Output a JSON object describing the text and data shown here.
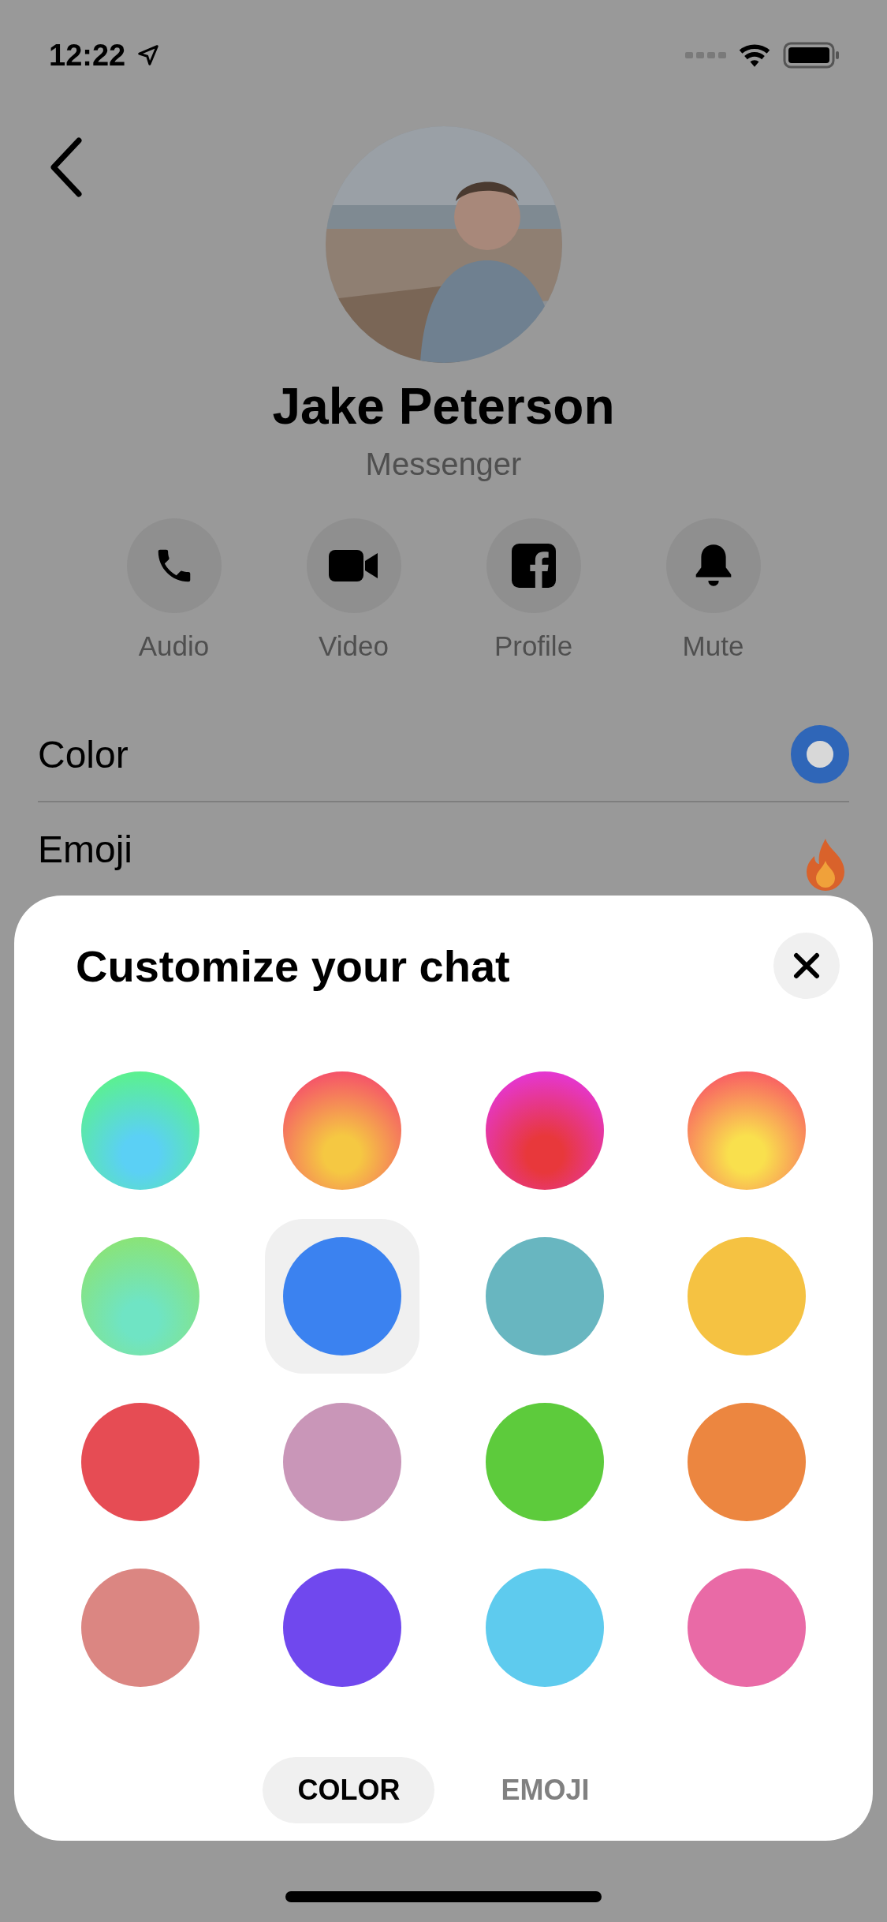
{
  "status_bar": {
    "time": "12:22"
  },
  "contact": {
    "name": "Jake Peterson",
    "subtitle": "Messenger"
  },
  "actions": [
    {
      "kind": "audio",
      "label": "Audio"
    },
    {
      "kind": "video",
      "label": "Video"
    },
    {
      "kind": "profile",
      "label": "Profile"
    },
    {
      "kind": "mute",
      "label": "Mute"
    }
  ],
  "settings": [
    {
      "kind": "color",
      "label": "Color"
    },
    {
      "kind": "emoji",
      "label": "Emoji"
    }
  ],
  "sheet": {
    "title": "Customize your chat",
    "swatches": [
      {
        "kind": "gradient",
        "color": "#5bd0f5",
        "selected": false
      },
      {
        "kind": "gradient",
        "color": "#f5c842",
        "selected": false
      },
      {
        "kind": "gradient",
        "color": "#e8383b",
        "selected": false
      },
      {
        "kind": "gradient",
        "color": "#f9e04d",
        "selected": false
      },
      {
        "kind": "gradient",
        "color": "#6fe4c4",
        "selected": false
      },
      {
        "kind": "solid",
        "color": "#3b82f0",
        "selected": true
      },
      {
        "kind": "solid",
        "color": "#68b6c0",
        "selected": false
      },
      {
        "kind": "solid",
        "color": "#f5c242",
        "selected": false
      },
      {
        "kind": "solid",
        "color": "#e64c54",
        "selected": false
      },
      {
        "kind": "solid",
        "color": "#c996b8",
        "selected": false
      },
      {
        "kind": "solid",
        "color": "#5dcb3c",
        "selected": false
      },
      {
        "kind": "solid",
        "color": "#ec8640",
        "selected": false
      },
      {
        "kind": "solid",
        "color": "#db8682",
        "selected": false
      },
      {
        "kind": "solid",
        "color": "#7048ee",
        "selected": false
      },
      {
        "kind": "solid",
        "color": "#5ecbee",
        "selected": false
      },
      {
        "kind": "solid",
        "color": "#e96aa6",
        "selected": false
      }
    ],
    "tabs": [
      {
        "label": "COLOR",
        "selected": true
      },
      {
        "label": "EMOJI",
        "selected": false
      }
    ]
  }
}
